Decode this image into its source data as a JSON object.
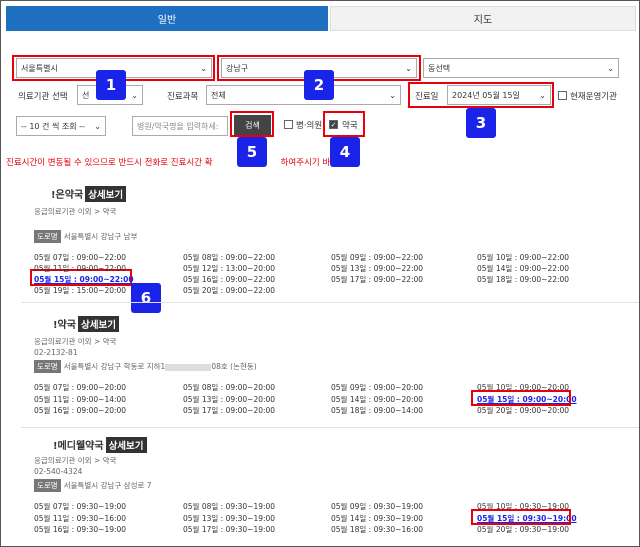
{
  "tabs": {
    "general": "일반",
    "map": "지도"
  },
  "filters": {
    "sido": "서울특별시",
    "gugun": "강남구",
    "dong": "동선택",
    "institution_label": "의료기관 선택",
    "institution_value": "선",
    "subject_label": "진료과목",
    "subject_value": "전체",
    "date_label": "진료일",
    "date_value": "2024년 05월 15일",
    "open_now": "현재운영기관",
    "per_page": "-- 10 건 씩 조회 --",
    "search_placeholder": "병원/약국명을 입력하세:",
    "search_button": "검색",
    "hospital_check": "병·의원",
    "pharmacy_check": "약국"
  },
  "badges": [
    "1",
    "2",
    "3",
    "4",
    "5",
    "6"
  ],
  "notice": "진료시간이 변동될 수 있으므로 반드시 전화로 진료시간 확",
  "notice_tail": "하여주시기 바",
  "detail_label": "상세보기",
  "road_label": "도로명",
  "cards": [
    {
      "name": "!은약국",
      "category": "응급의료기관 이외 > 약국",
      "phone": "",
      "address": "서울특별시 강남구 남부",
      "schedule": [
        [
          "05월 07일 : 09:00~22:00",
          "05월 08일 : 09:00~22:00",
          "05월 09일 : 09:00~22:00",
          "05월 10일 : 09:00~22:00"
        ],
        [
          "05월 11일 : 09:00~22:00",
          "05월 12일 : 13:00~20:00",
          "05월 13일 : 09:00~22:00",
          "05월 14일 : 09:00~22:00"
        ],
        [
          "05월 15일 : 09:00~22:00",
          "05월 16일 : 09:00~22:00",
          "05월 17일 : 09:00~22:00",
          "05월 18일 : 09:00~22:00"
        ],
        [
          "05월 19일 : 15:00~20:00",
          "05월 20일 : 09:00~22:00",
          "",
          ""
        ]
      ]
    },
    {
      "name": "!약국",
      "category": "응급의료기관 이외 > 약국",
      "phone": "02-2132-81",
      "address": "서울특별시 강남구 학동로 지하1",
      "address_tail": "08호 (논현동)",
      "schedule": [
        [
          "05월 07일 : 09:00~20:00",
          "05월 08일 : 09:00~20:00",
          "05월 09일 : 09:00~20:00",
          "05월 10일 : 09:00~20:00"
        ],
        [
          "05월 11일 : 09:00~14:00",
          "05월 13일 : 09:00~20:00",
          "05월 14일 : 09:00~20:00",
          "05월 15일 : 09:00~20:00"
        ],
        [
          "05월 16일 : 09:00~20:00",
          "05월 17일 : 09:00~20:00",
          "05월 18일 : 09:00~14:00",
          "05월 20일 : 09:00~20:00"
        ]
      ]
    },
    {
      "name": "!메디웰약국",
      "category": "응급의료기관 이외 > 약국",
      "phone": "02-540-4324",
      "address": "서울특별시 강남구 삼성로 7",
      "schedule": [
        [
          "05월 07일 : 09:30~19:00",
          "05월 08일 : 09:30~19:00",
          "05월 09일 : 09:30~19:00",
          "05월 10일 : 09:30~19:00"
        ],
        [
          "05월 11일 : 09:30~16:00",
          "05월 13일 : 09:30~19:00",
          "05월 14일 : 09:30~19:00",
          "05월 15일 : 09:30~19:00"
        ],
        [
          "05월 16일 : 09:30~19:00",
          "05월 17일 : 09:30~19:00",
          "05월 18일 : 09:30~16:00",
          "05월 20일 : 09:30~19:00"
        ]
      ]
    }
  ],
  "colors": {
    "accent": "#1f6fc0",
    "highlight": "#e8000c",
    "badge": "#1a24e8"
  }
}
